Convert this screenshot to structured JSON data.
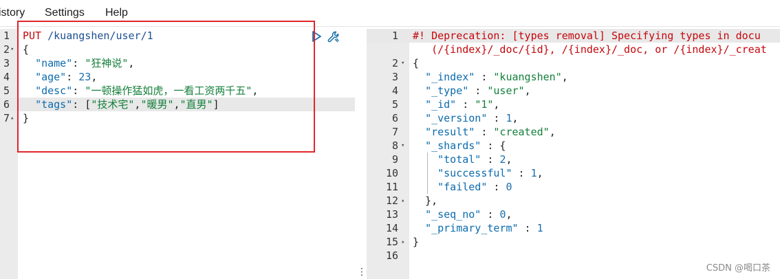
{
  "menu": {
    "history": "istory",
    "settings": "Settings",
    "help": "Help"
  },
  "request": {
    "lines": [
      {
        "num": "1",
        "fold": "",
        "parts": [
          [
            "t-method",
            "PUT"
          ],
          [
            "t-punc",
            " "
          ],
          [
            "t-url",
            "/kuangshen/user/1"
          ]
        ]
      },
      {
        "num": "2",
        "fold": "▾",
        "parts": [
          [
            "t-punc",
            "{"
          ]
        ]
      },
      {
        "num": "3",
        "fold": "",
        "parts": [
          [
            "t-punc",
            "  "
          ],
          [
            "t-key",
            "\"name\""
          ],
          [
            "t-punc",
            ": "
          ],
          [
            "t-str",
            "\"狂神说\""
          ],
          [
            "t-punc",
            ","
          ]
        ]
      },
      {
        "num": "4",
        "fold": "",
        "parts": [
          [
            "t-punc",
            "  "
          ],
          [
            "t-key",
            "\"age\""
          ],
          [
            "t-punc",
            ": "
          ],
          [
            "t-num",
            "23"
          ],
          [
            "t-punc",
            ","
          ]
        ]
      },
      {
        "num": "5",
        "fold": "",
        "parts": [
          [
            "t-punc",
            "  "
          ],
          [
            "t-key",
            "\"desc\""
          ],
          [
            "t-punc",
            ": "
          ],
          [
            "t-str",
            "\"一顿操作猛如虎，一看工资两千五\""
          ],
          [
            "t-punc",
            ","
          ]
        ]
      },
      {
        "num": "6",
        "fold": "",
        "active": true,
        "parts": [
          [
            "t-punc",
            "  "
          ],
          [
            "t-key",
            "\"tags\""
          ],
          [
            "t-punc",
            ": ["
          ],
          [
            "t-str",
            "\"技术宅\""
          ],
          [
            "t-punc",
            ","
          ],
          [
            "t-str",
            "\"暖男\""
          ],
          [
            "t-punc",
            ","
          ],
          [
            "t-str",
            "\"直男\""
          ],
          [
            "t-punc",
            "]"
          ]
        ]
      },
      {
        "num": "7",
        "fold": "▴",
        "parts": [
          [
            "t-punc",
            "}"
          ]
        ]
      }
    ]
  },
  "response": {
    "lines": [
      {
        "num": "1",
        "fold": "",
        "active": true,
        "parts": [
          [
            "t-comment",
            "#! Deprecation: [types removal] Specifying types in docu"
          ]
        ]
      },
      {
        "num": "",
        "fold": "",
        "parts": [
          [
            "t-comment",
            "   (/{index}/_doc/{id}, /{index}/_doc, or /{index}/_creat"
          ]
        ]
      },
      {
        "num": "2",
        "fold": "▾",
        "parts": [
          [
            "t-punc",
            "{"
          ]
        ]
      },
      {
        "num": "3",
        "fold": "",
        "parts": [
          [
            "t-punc",
            "  "
          ],
          [
            "t-key",
            "\"_index\""
          ],
          [
            "t-punc",
            " : "
          ],
          [
            "t-str",
            "\"kuangshen\""
          ],
          [
            "t-punc",
            ","
          ]
        ]
      },
      {
        "num": "4",
        "fold": "",
        "parts": [
          [
            "t-punc",
            "  "
          ],
          [
            "t-key",
            "\"_type\""
          ],
          [
            "t-punc",
            " : "
          ],
          [
            "t-str",
            "\"user\""
          ],
          [
            "t-punc",
            ","
          ]
        ]
      },
      {
        "num": "5",
        "fold": "",
        "parts": [
          [
            "t-punc",
            "  "
          ],
          [
            "t-key",
            "\"_id\""
          ],
          [
            "t-punc",
            " : "
          ],
          [
            "t-str",
            "\"1\""
          ],
          [
            "t-punc",
            ","
          ]
        ]
      },
      {
        "num": "6",
        "fold": "",
        "parts": [
          [
            "t-punc",
            "  "
          ],
          [
            "t-key",
            "\"_version\""
          ],
          [
            "t-punc",
            " : "
          ],
          [
            "t-num",
            "1"
          ],
          [
            "t-punc",
            ","
          ]
        ]
      },
      {
        "num": "7",
        "fold": "",
        "parts": [
          [
            "t-punc",
            "  "
          ],
          [
            "t-key",
            "\"result\""
          ],
          [
            "t-punc",
            " : "
          ],
          [
            "t-str",
            "\"created\""
          ],
          [
            "t-punc",
            ","
          ]
        ]
      },
      {
        "num": "8",
        "fold": "▾",
        "parts": [
          [
            "t-punc",
            "  "
          ],
          [
            "t-key",
            "\"_shards\""
          ],
          [
            "t-punc",
            " : {"
          ]
        ]
      },
      {
        "num": "9",
        "fold": "",
        "parts": [
          [
            "t-punc",
            "    "
          ],
          [
            "t-key",
            "\"total\""
          ],
          [
            "t-punc",
            " : "
          ],
          [
            "t-num",
            "2"
          ],
          [
            "t-punc",
            ","
          ]
        ]
      },
      {
        "num": "10",
        "fold": "",
        "parts": [
          [
            "t-punc",
            "    "
          ],
          [
            "t-key",
            "\"successful\""
          ],
          [
            "t-punc",
            " : "
          ],
          [
            "t-num",
            "1"
          ],
          [
            "t-punc",
            ","
          ]
        ]
      },
      {
        "num": "11",
        "fold": "",
        "parts": [
          [
            "t-punc",
            "    "
          ],
          [
            "t-key",
            "\"failed\""
          ],
          [
            "t-punc",
            " : "
          ],
          [
            "t-num",
            "0"
          ]
        ]
      },
      {
        "num": "12",
        "fold": "▴",
        "parts": [
          [
            "t-punc",
            "  },"
          ]
        ]
      },
      {
        "num": "13",
        "fold": "",
        "parts": [
          [
            "t-punc",
            "  "
          ],
          [
            "t-key",
            "\"_seq_no\""
          ],
          [
            "t-punc",
            " : "
          ],
          [
            "t-num",
            "0"
          ],
          [
            "t-punc",
            ","
          ]
        ]
      },
      {
        "num": "14",
        "fold": "",
        "parts": [
          [
            "t-punc",
            "  "
          ],
          [
            "t-key",
            "\"_primary_term\""
          ],
          [
            "t-punc",
            " : "
          ],
          [
            "t-num",
            "1"
          ]
        ]
      },
      {
        "num": "15",
        "fold": "▴",
        "parts": [
          [
            "t-punc",
            "}"
          ]
        ]
      },
      {
        "num": "16",
        "fold": "",
        "parts": []
      }
    ]
  },
  "icons": {
    "run": "play-icon",
    "settings": "wrench-icon",
    "drag": "vertical-ellipsis-icon"
  },
  "watermark": "CSDN @喝口茶",
  "colors": {
    "highlight_box": "#e0262b",
    "comment": "#c5060b",
    "string": "#14803b",
    "key": "#0b6bae"
  }
}
